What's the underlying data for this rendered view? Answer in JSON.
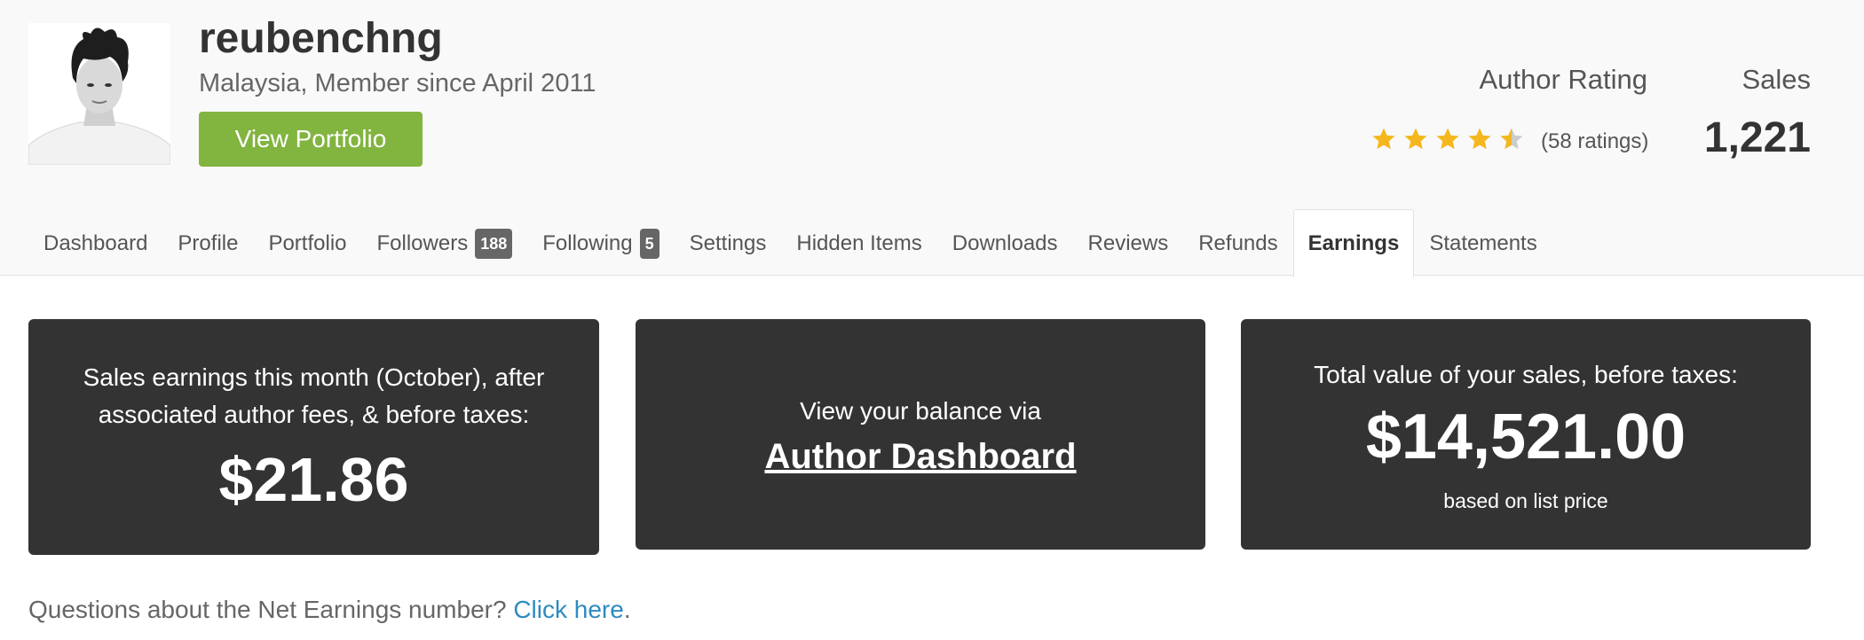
{
  "profile": {
    "username": "reubenchng",
    "location": "Malaysia, Member since April 2011",
    "portfolio_button": "View Portfolio"
  },
  "stats": {
    "rating_label": "Author Rating",
    "rating_value": 4.5,
    "rating_count": "(58 ratings)",
    "sales_label": "Sales",
    "sales_value": "1,221",
    "star_color": "#f5b71e",
    "star_empty_color": "#cccccc"
  },
  "tabs": [
    {
      "label": "Dashboard"
    },
    {
      "label": "Profile"
    },
    {
      "label": "Portfolio"
    },
    {
      "label": "Followers",
      "badge": "188"
    },
    {
      "label": "Following",
      "badge": "5"
    },
    {
      "label": "Settings"
    },
    {
      "label": "Hidden Items"
    },
    {
      "label": "Downloads"
    },
    {
      "label": "Reviews"
    },
    {
      "label": "Refunds"
    },
    {
      "label": "Earnings",
      "active": true
    },
    {
      "label": "Statements"
    }
  ],
  "cards": {
    "monthly": {
      "description": "Sales earnings this month (October), after associated author fees, & before taxes:",
      "amount": "$21.86"
    },
    "balance": {
      "description": "View your balance via",
      "link": "Author Dashboard"
    },
    "total": {
      "description": "Total value of your sales, before taxes:",
      "amount": "$14,521.00",
      "note": "based on list price"
    }
  },
  "help": {
    "text": "Questions about the Net Earnings number? ",
    "link": "Click here",
    "suffix": "."
  },
  "colors": {
    "accent_green": "#82b440",
    "card_bg": "#333333",
    "link_blue": "#2e8bc0"
  }
}
